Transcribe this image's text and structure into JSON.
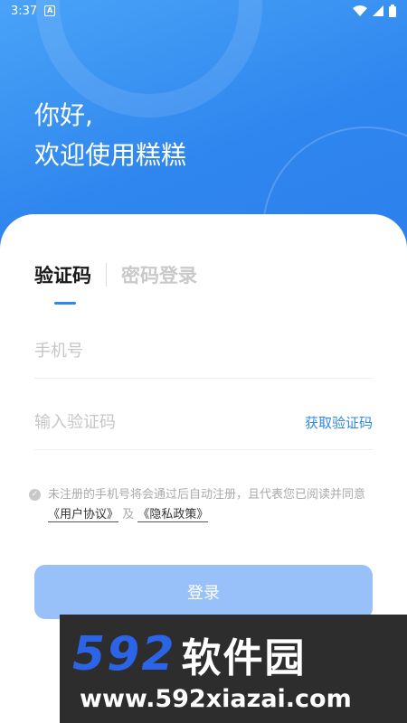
{
  "status_bar": {
    "time": "3:37",
    "notification_badge": "A",
    "icons": [
      "wifi-icon",
      "signal-icon",
      "battery-icon"
    ]
  },
  "greeting": {
    "line1": "你好,",
    "line2": "欢迎使用糕糕"
  },
  "tabs": [
    {
      "label": "验证码",
      "active": true
    },
    {
      "label": "密码登录",
      "active": false
    }
  ],
  "phone_field": {
    "placeholder": "手机号",
    "value": ""
  },
  "code_field": {
    "placeholder": "输入验证码",
    "value": "",
    "action_label": "获取验证码"
  },
  "agreement": {
    "text_before": "未注册的手机号将会通过后自动注册，且代表您已阅读并同意",
    "user_agreement": "《用户协议》",
    "connector": "及",
    "privacy_policy": "《隐私政策》"
  },
  "login_button": {
    "label": "登录"
  },
  "watermark": {
    "logo_number": "592",
    "logo_text": "软件园",
    "url": "www.592xiazai.com"
  },
  "colors": {
    "primary": "#2f86ee",
    "button_disabled": "#98c0f9",
    "watermark_blue": "#2c64e8"
  }
}
